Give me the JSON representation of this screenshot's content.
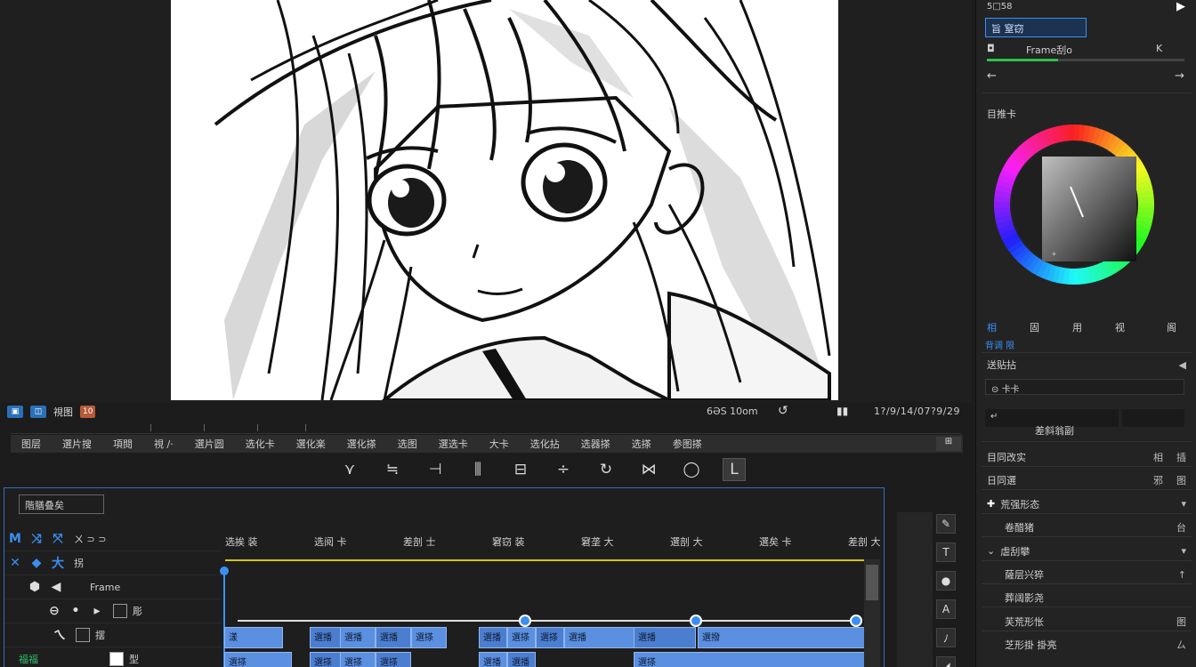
{
  "canvas_toolbar": {
    "view_label": "視图",
    "badge": "10",
    "fps": "6ƏS 10om",
    "timecode": "1?/9/14/07?9/29"
  },
  "menu": [
    "图层",
    "選片搜",
    "項閱",
    "視 ∕·",
    "選片圆",
    "选化卡",
    "選化楽",
    "選化搽",
    "选图",
    "選选卡",
    "大卡",
    "选化拈",
    "选器搽",
    "选搽",
    "参图搽"
  ],
  "menu_end": "⊞",
  "tools": [
    {
      "name": "select-tool",
      "glyph": "⋎"
    },
    {
      "name": "text-tool",
      "glyph": "≒"
    },
    {
      "name": "crop-tool",
      "glyph": "⊣"
    },
    {
      "name": "bars-tool",
      "glyph": "⫼"
    },
    {
      "name": "align-tool",
      "glyph": "⊟"
    },
    {
      "name": "distribute-tool",
      "glyph": "÷"
    },
    {
      "name": "rotate-tool",
      "glyph": "↻"
    },
    {
      "name": "mirror-tool",
      "glyph": "⋈"
    },
    {
      "name": "lasso-tool",
      "glyph": "◯"
    },
    {
      "name": "frame-tool",
      "glyph": "L"
    }
  ],
  "timeline": {
    "search": "階膳叠矣",
    "ruler_labels": [
      "选挨 装",
      "选阅 卡",
      "差剖 士",
      "窘窃 装",
      "窘垄 大",
      "選剖 大",
      "選矣 卡",
      "差剖 大"
    ],
    "track_rows": [
      {
        "icons": [
          "M",
          "⤨",
          "⤧"
        ],
        "text": "ㄨ  ⊃  ⊃",
        "icon_name": "motion-icon"
      },
      {
        "icons": [
          "✕",
          "◆",
          "大"
        ],
        "text": "拐",
        "icon_name": "marker-icon"
      },
      {
        "icons": [
          "⬢",
          "◀"
        ],
        "text": "Frame",
        "icon_name": "frame-icon"
      },
      {
        "icons": [
          "⊖",
          "•",
          "▸"
        ],
        "text": "彫",
        "icon_name": "layer-icon"
      },
      {
        "icons": [
          "ㄟ"
        ],
        "text": "摆",
        "icon_name": "curve-icon"
      },
      {
        "icons": [
          "​"
        ],
        "text": "型",
        "icon_name": "track-icon"
      }
    ],
    "last_row_green": "福福",
    "clips_row1": [
      "漾",
      "選播",
      "選播",
      "選播",
      "選搽",
      "選播",
      "選搽",
      "選搽",
      "選播",
      "選播",
      "選撥",
      "選播",
      "選搽"
    ],
    "clips_row2": [
      "選搽",
      "選搽",
      "選搽",
      "選搽",
      "選播",
      "選播",
      "選搽",
      "選搽"
    ]
  },
  "right_panel": {
    "top_label": "5□58",
    "selected_brush": "旨  窒窃",
    "brush_name": "Frame刮o",
    "brush_end": "K",
    "brush_progress": 0.36,
    "color_label": "目推卡",
    "modes": [
      "相",
      "固",
      "用",
      "视",
      "阁"
    ],
    "mode_sub": "背调 限",
    "layers_title": "送贴拈",
    "layer_search": "卡卡",
    "layer_btn": "差斜翁副",
    "layer_rows": [
      {
        "label": "目同改实",
        "ico": "插",
        "ico2": "相"
      },
      {
        "label": "日同選",
        "ico": "图",
        "ico2": "邪"
      },
      {
        "label": "荒强形态",
        "ico": "▾",
        "ico2": ""
      },
      {
        "label": "卷醋猪",
        "ico": "台",
        "ico2": ""
      },
      {
        "label": "虐刮攀",
        "ico": "▾",
        "ico2": ""
      },
      {
        "label": "薩层兴猝",
        "ico": "↑",
        "ico2": ""
      },
      {
        "label": "葬阔影尧",
        "ico": "",
        "ico2": ""
      },
      {
        "label": "芙荒形怅",
        "ico": "图",
        "ico2": ""
      },
      {
        "label": "芝形掛 掛亮",
        "ico": "ㄙ",
        "ico2": ""
      }
    ]
  },
  "colors": {
    "accent": "#3b8ff0",
    "clip": "#5b8fe0",
    "playline": "#d8c21a",
    "progress": "#2fbe4c"
  }
}
